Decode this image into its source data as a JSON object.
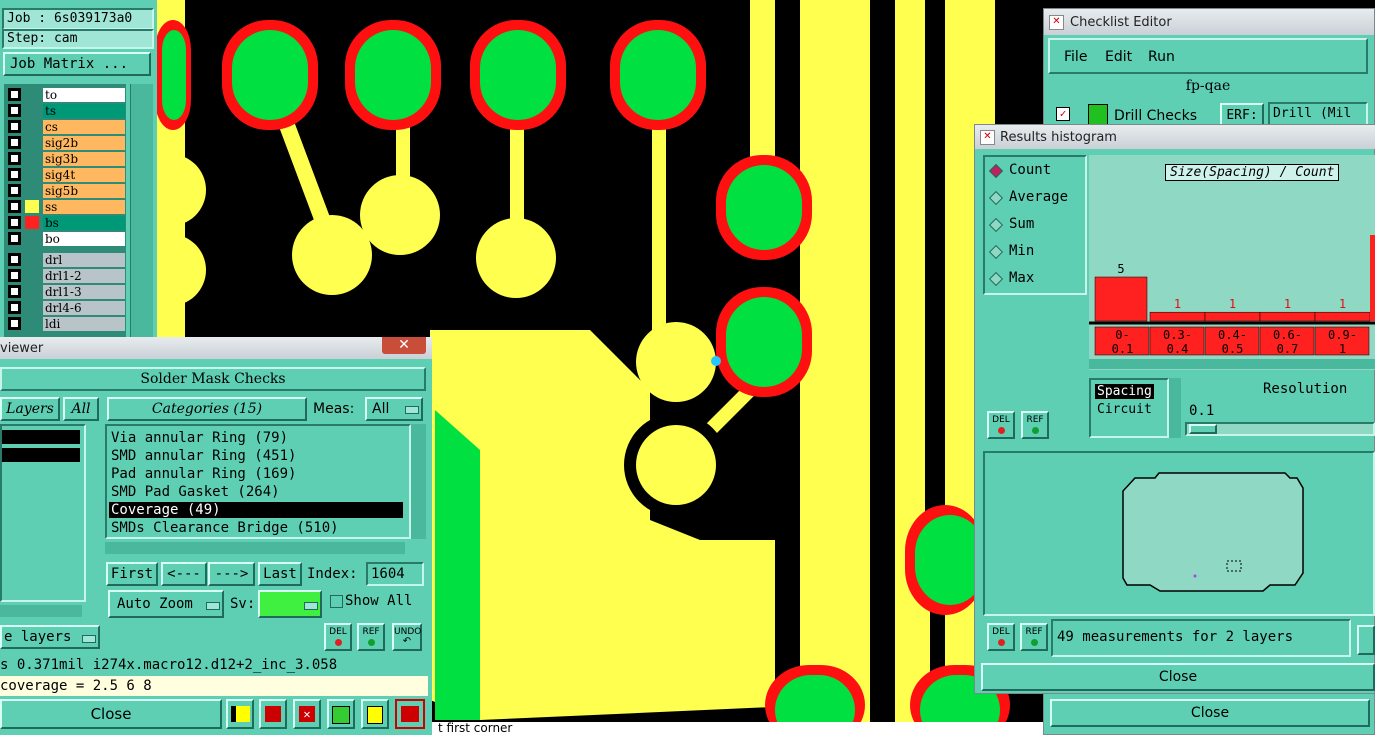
{
  "job_panel": {
    "job": "Job : 6s039173a0",
    "step": "Step: cam",
    "job_matrix": "Job Matrix ...",
    "layers": [
      {
        "name": "to",
        "color": "#ffffff"
      },
      {
        "name": "ts",
        "color": "#009977"
      },
      {
        "name": "cs",
        "color": "#ffb860"
      },
      {
        "name": "sig2b",
        "color": "#ffb860"
      },
      {
        "name": "sig3b",
        "color": "#ffb860"
      },
      {
        "name": "sig4t",
        "color": "#ffb860"
      },
      {
        "name": "sig5b",
        "color": "#ffb860"
      },
      {
        "name": "ss",
        "color": "#ffb860"
      },
      {
        "name": "bs",
        "color": "#009977"
      },
      {
        "name": "bo",
        "color": "#ffffff"
      },
      {
        "name": "drl",
        "color": "#b8c4c8"
      },
      {
        "name": "drl1-2",
        "color": "#b8c4c8"
      },
      {
        "name": "drl1-3",
        "color": "#b8c4c8"
      },
      {
        "name": "drl4-6",
        "color": "#b8c4c8"
      },
      {
        "name": "ldi",
        "color": "#b8c4c8"
      }
    ]
  },
  "viewer": {
    "title": "viewer",
    "header": "Solder Mask Checks",
    "layers_label": "Layers",
    "all_label": "All",
    "categories_label": "Categories (15)",
    "meas_label": "Meas:",
    "meas_value": "All",
    "categories": [
      {
        "text": "Via annular Ring (79)",
        "selected": false
      },
      {
        "text": "SMD annular Ring (451)",
        "selected": false
      },
      {
        "text": "Pad annular Ring (169)",
        "selected": false
      },
      {
        "text": "SMD Pad Gasket (264)",
        "selected": false
      },
      {
        "text": "Coverage (49)",
        "selected": true
      },
      {
        "text": "SMDs Clearance Bridge (510)",
        "selected": false
      }
    ],
    "first": "First",
    "prev": "<---",
    "next": "--->",
    "last": "Last",
    "index_label": "Index:",
    "index_value": "1604",
    "auto_zoom": "Auto Zoom",
    "sv_label": "Sv:",
    "show_all": "Show All",
    "layers_dd": "e layers",
    "del": "DEL",
    "ref": "REF",
    "undo": "UNDO",
    "status1": "s 0.371mil  i274x.macro12.d12+2_inc_3.058",
    "status2": "coverage = 2.5 6 8",
    "close": "Close"
  },
  "canvas": {
    "prompt": "t first corner"
  },
  "checklist": {
    "title": "Checklist Editor",
    "menu": [
      "File",
      "Edit",
      "Run"
    ],
    "name": "fp-qae",
    "drill_checks": "Drill Checks",
    "erf_label": "ERF:",
    "erf_value": "Drill (Mil",
    "close": "Close"
  },
  "histogram": {
    "title": "Results histogram",
    "modes": [
      {
        "label": "Count",
        "selected": true
      },
      {
        "label": "Average",
        "selected": false
      },
      {
        "label": "Sum",
        "selected": false
      },
      {
        "label": "Min",
        "selected": false
      },
      {
        "label": "Max",
        "selected": false
      }
    ],
    "chart_title": "Size(Spacing) / Count",
    "del": "DEL",
    "ref": "REF",
    "spacing_label": "Spacing",
    "circuit_label": "Circuit",
    "resolution_label": "Resolution",
    "resolution_value": "0.1",
    "measurements": "49 measurements for 2 layers",
    "close": "Close"
  },
  "chart_data": {
    "type": "bar",
    "categories": [
      "0-0.1",
      "0.3-0.4",
      "0.4-0.5",
      "0.6-0.7",
      "0.9-1"
    ],
    "values": [
      5,
      1,
      1,
      1,
      1
    ],
    "title": "Size(Spacing) / Count",
    "color": "#ff2020"
  }
}
